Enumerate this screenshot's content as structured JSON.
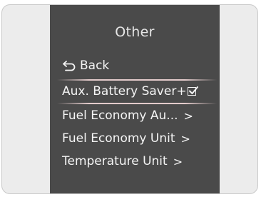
{
  "menu": {
    "title": "Other",
    "back_label": "Back",
    "items": [
      {
        "label": "Aux. Battery Saver+",
        "control": "checkbox",
        "checked": true,
        "selected": true
      },
      {
        "label": "Fuel Economy Au...",
        "control": "chevron",
        "chevron": ">"
      },
      {
        "label": "Fuel Economy Unit",
        "control": "chevron",
        "chevron": ">"
      },
      {
        "label": "Temperature Unit",
        "control": "chevron",
        "chevron": ">"
      }
    ]
  },
  "icons": {
    "back": "back-arrow-icon",
    "chevron": "chevron-right-icon",
    "checkbox": "checkbox-checked-icon"
  },
  "colors": {
    "screen_bg": "#4a4a4a",
    "text": "#f4f4f4",
    "selection_line": "#ebd2d2"
  }
}
